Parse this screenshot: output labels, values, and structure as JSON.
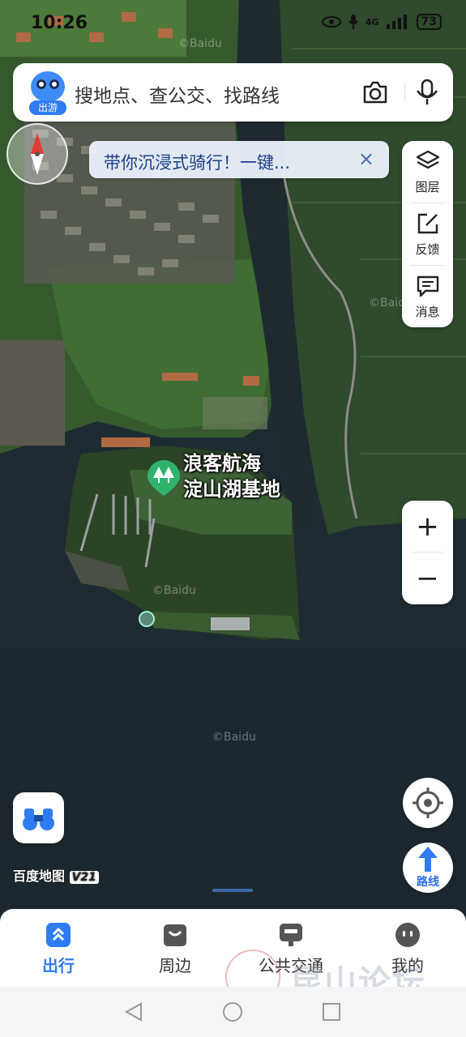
{
  "status_bar": {
    "time": "10:26",
    "network": "4G",
    "battery": "73"
  },
  "search": {
    "logo_tag": "出游",
    "placeholder": "搜地点、查公交、找路线",
    "camera_icon": "camera-icon",
    "mic_icon": "microphone-icon"
  },
  "banner": {
    "text": "带你沉浸式骑行！一键...",
    "close": "×"
  },
  "map_tools": [
    {
      "label": "图层",
      "icon": "layers-icon"
    },
    {
      "label": "反馈",
      "icon": "feedback-icon"
    },
    {
      "label": "消息",
      "icon": "message-icon"
    }
  ],
  "zoom": {
    "in": "+",
    "out": "−"
  },
  "poi": {
    "name_line1": "浪客航海",
    "name_line2": "淀山湖基地",
    "icon": "park-tree-icon"
  },
  "route_button": {
    "label": "路线"
  },
  "map_brand": {
    "name": "百度地图",
    "version": "V21"
  },
  "watermarks": [
    "©Baidu",
    "©Baidu",
    "©Baidu",
    "©Baidu"
  ],
  "bottom_nav": [
    {
      "label": "出行",
      "icon": "travel-icon",
      "active": true
    },
    {
      "label": "周边",
      "icon": "nearby-bag-icon",
      "active": false
    },
    {
      "label": "公共交通",
      "icon": "bus-icon",
      "active": false
    },
    {
      "label": "我的",
      "icon": "profile-face-icon",
      "active": false
    }
  ],
  "forum_watermark": "昆山论坛",
  "colors": {
    "accent": "#2f7cf2",
    "banner_text": "#1c3f87",
    "water": "#1f2b33",
    "vegetation": "#3e6a34"
  }
}
